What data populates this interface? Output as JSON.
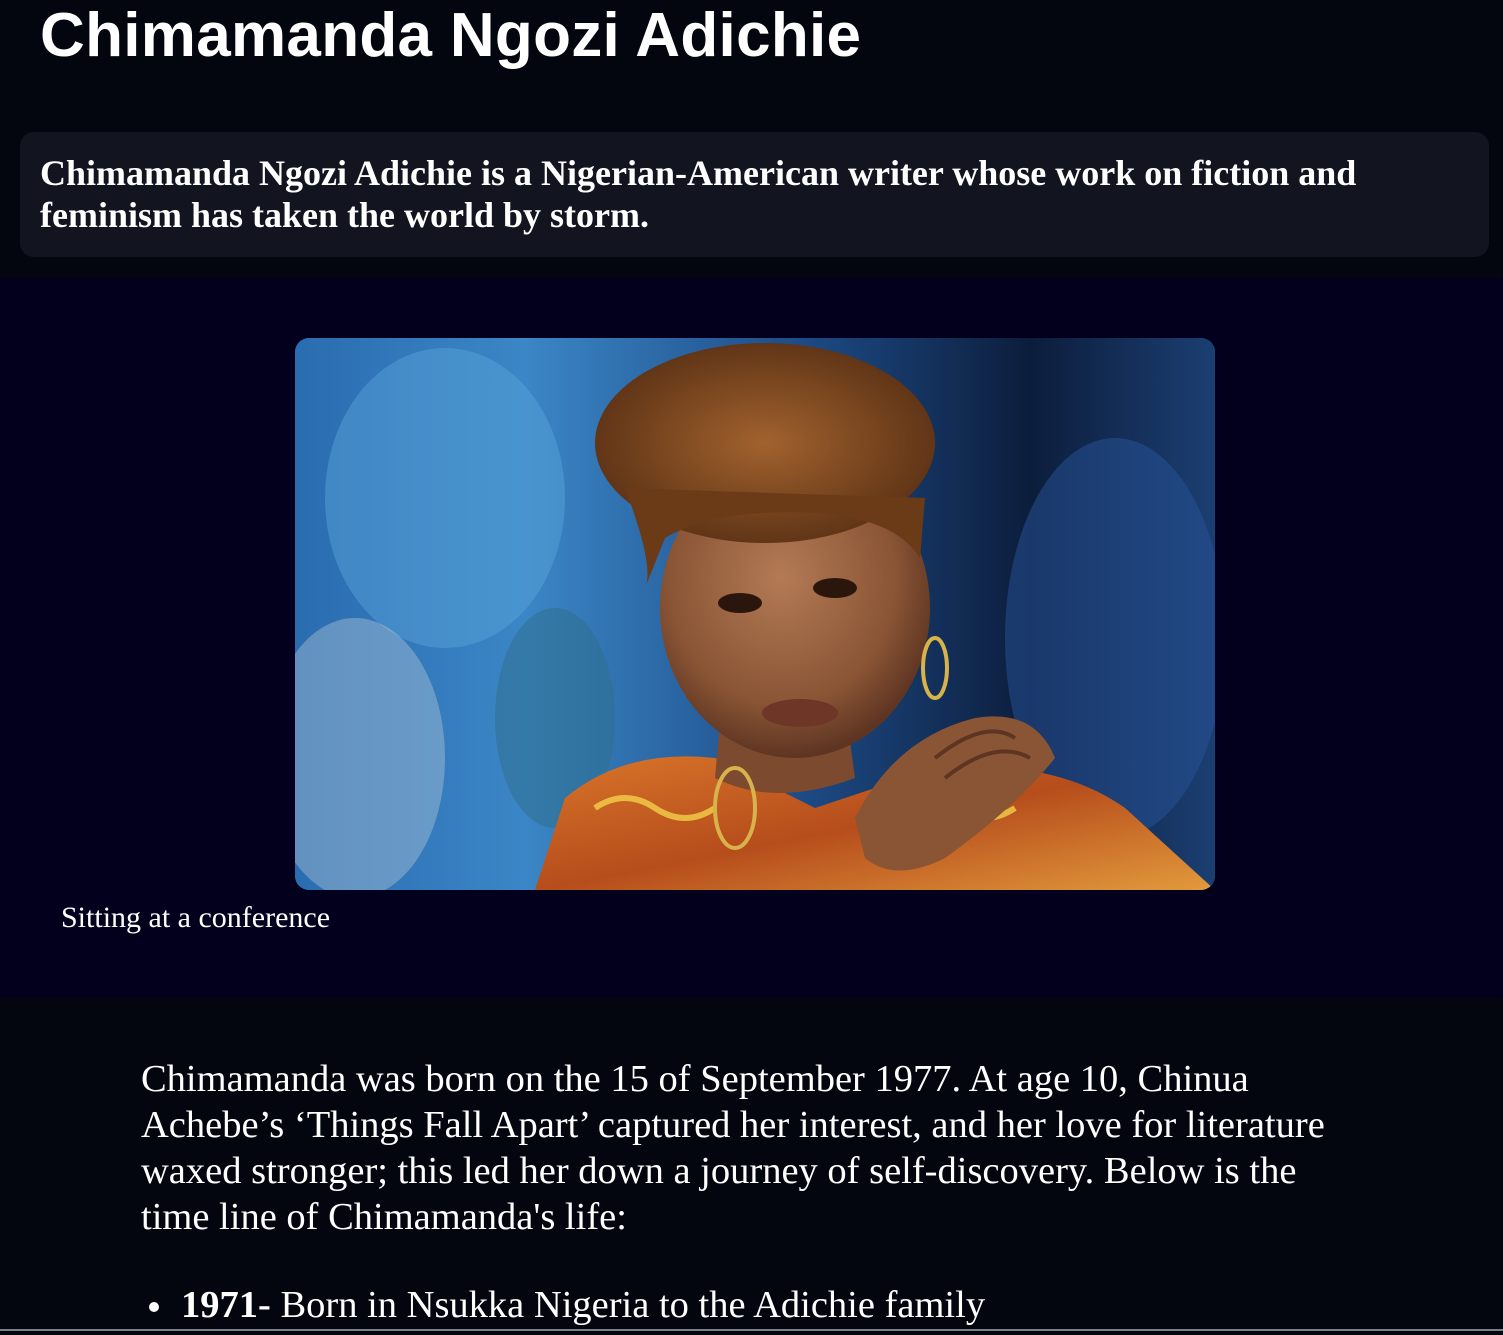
{
  "header": {
    "title": "Chimamanda Ngozi Adichie",
    "intro": "Chimamanda Ngozi Adichie is a Nigerian-American writer whose work on fiction and feminism has taken the world by storm."
  },
  "figure": {
    "caption": "Sitting at a conference"
  },
  "bio": {
    "paragraph": "Chimamanda was born on the 15 of September 1977. At age 10, Chinua Achebe’s ‘Things Fall Apart’ captured her interest, and her love for literature waxed stronger; this led her down a journey of self-discovery. Below is the time line of Chimamanda's life:",
    "timeline": [
      {
        "year": "1971-",
        "event": " Born in Nsukka Nigeria to the Adichie family"
      }
    ]
  },
  "colors": {
    "page_background": "#03050f",
    "intro_card": "#121520",
    "photo_section": "#02001d",
    "text": "#ffffff"
  }
}
